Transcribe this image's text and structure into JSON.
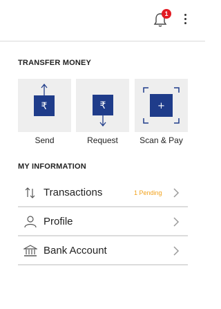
{
  "appbar": {
    "notification_count": "1",
    "icons": {
      "bell": "bell-icon",
      "menu": "more-vertical-icon"
    }
  },
  "transfer": {
    "title": "TRANSFER MONEY",
    "tiles": [
      {
        "label": "Send",
        "icon": "send-rupee-icon",
        "glyph": "₹"
      },
      {
        "label": "Request",
        "icon": "request-rupee-icon",
        "glyph": "₹"
      },
      {
        "label": "Scan & Pay",
        "icon": "scan-icon",
        "glyph": "+"
      }
    ]
  },
  "info": {
    "title": "MY INFORMATION",
    "rows": [
      {
        "label": "Transactions",
        "status": "1 Pending",
        "icon": "transactions-icon"
      },
      {
        "label": "Profile",
        "icon": "profile-icon"
      },
      {
        "label": "Bank Account",
        "icon": "bank-icon"
      }
    ]
  },
  "colors": {
    "brand_navy": "#1f3c8a",
    "badge_red": "#e21b23",
    "pending_orange": "#f2a21b"
  }
}
